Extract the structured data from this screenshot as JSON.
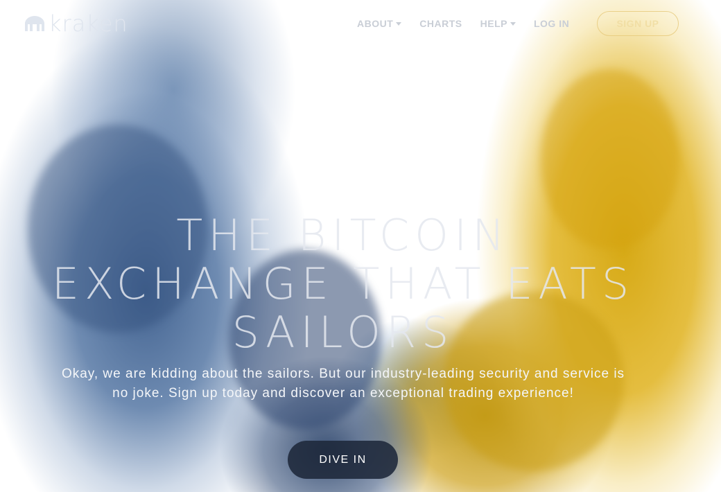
{
  "brand": {
    "logo_text": "kraken"
  },
  "nav": {
    "items": [
      {
        "label": "ABOUT",
        "has_caret": true
      },
      {
        "label": "CHARTS",
        "has_caret": false
      },
      {
        "label": "HELP",
        "has_caret": true
      },
      {
        "label": "LOG IN",
        "has_caret": false
      }
    ],
    "signup_label": "SIGN UP"
  },
  "hero": {
    "headline": "THE BITCOIN EXCHANGE THAT EATS SAILORS",
    "subhead": "Okay, we are kidding about the sailors. But our industry-leading security and service is no joke. Sign up today and discover an exceptional trading experience!",
    "cta_label": "DIVE IN"
  },
  "colors": {
    "ink_blue": "#3a5c8c",
    "ink_yellow": "#d6a812",
    "cta_bg": "#1e283a",
    "nav_text": "#c9ced6"
  },
  "icons": {
    "logo": "kraken-logo-icon",
    "caret": "caret-down-icon"
  }
}
